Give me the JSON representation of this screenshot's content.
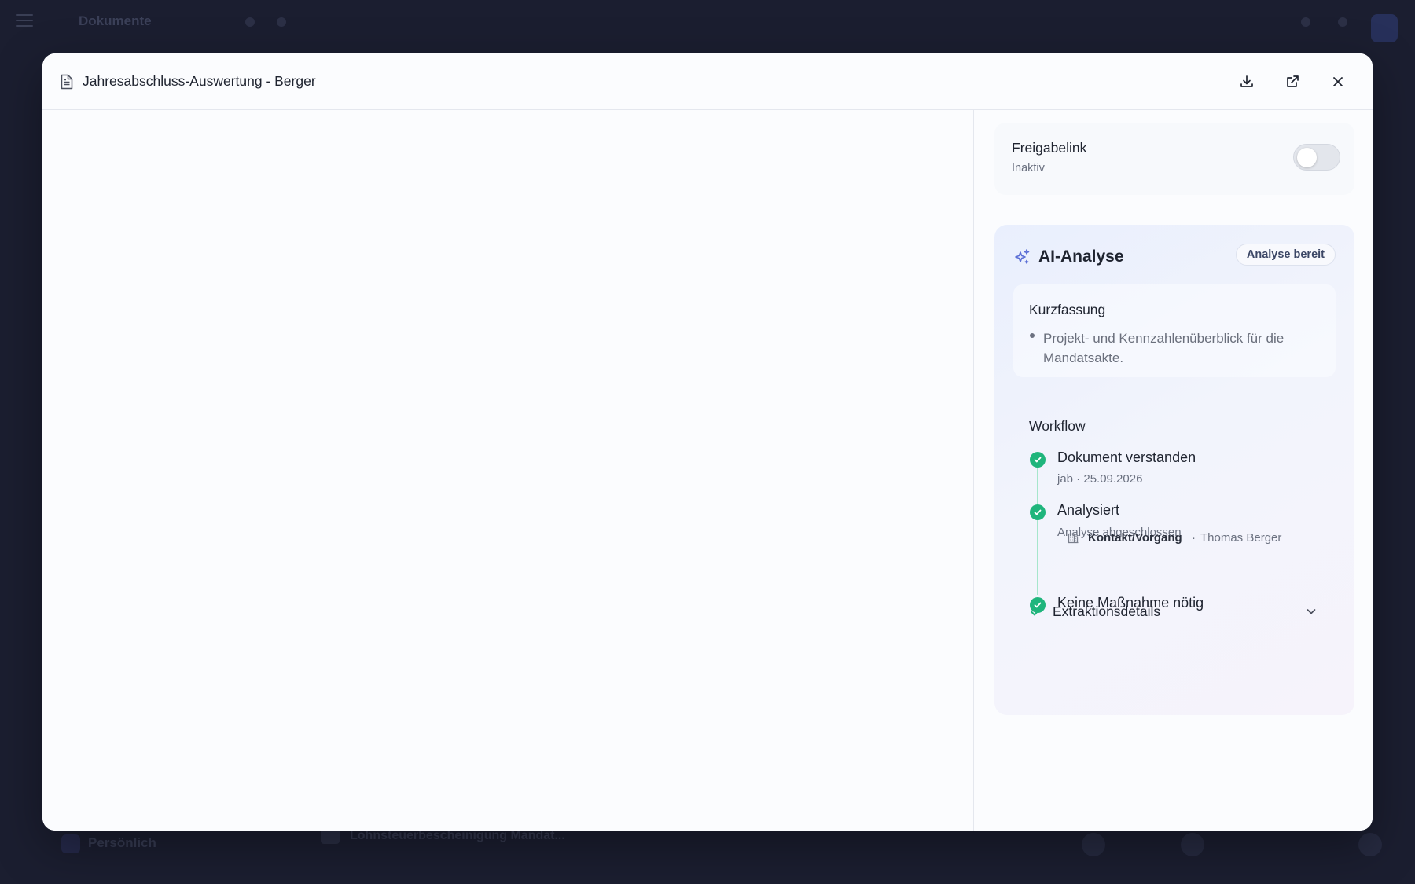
{
  "background": {
    "app_title": "Dokumente",
    "sidebar_label": "Persönlich",
    "row_label": "Lohnsteuerbescheinigung Mandat..."
  },
  "modal": {
    "title": "Jahresabschluss-Auswertung - Berger",
    "icons": {
      "document": "document-icon",
      "download": "download-icon",
      "open_external": "external-link-icon",
      "close": "close-icon"
    }
  },
  "share_link": {
    "title": "Freigabelink",
    "status": "Inaktiv",
    "enabled": false
  },
  "ai_analysis": {
    "title": "AI-Analyse",
    "badge": "Analyse bereit",
    "summary": {
      "title": "Kurzfassung",
      "bullets": [
        "Projekt- und Kennzahlenüberblick für die Mandatsakte."
      ]
    },
    "workflow": {
      "title": "Workflow",
      "steps": [
        {
          "label": "Dokument verstanden",
          "sub": "jab · 25.09.2026",
          "status": "done"
        },
        {
          "label": "Analysiert",
          "sub": "Analyse abgeschlossen",
          "status": "done"
        },
        {
          "label": "Keine Maßnahme nötig",
          "sub": "",
          "status": "done"
        }
      ],
      "contact": {
        "label": "Kontakt/Vorgang",
        "separator": "·",
        "name": "Thomas Berger"
      }
    },
    "extraction": {
      "label": "Extraktionsdetails",
      "expanded": false
    }
  },
  "colors": {
    "accent_green": "#1fb57c",
    "backdrop": "#1b1e30",
    "sparkle_blue": "#5b6fd6"
  }
}
